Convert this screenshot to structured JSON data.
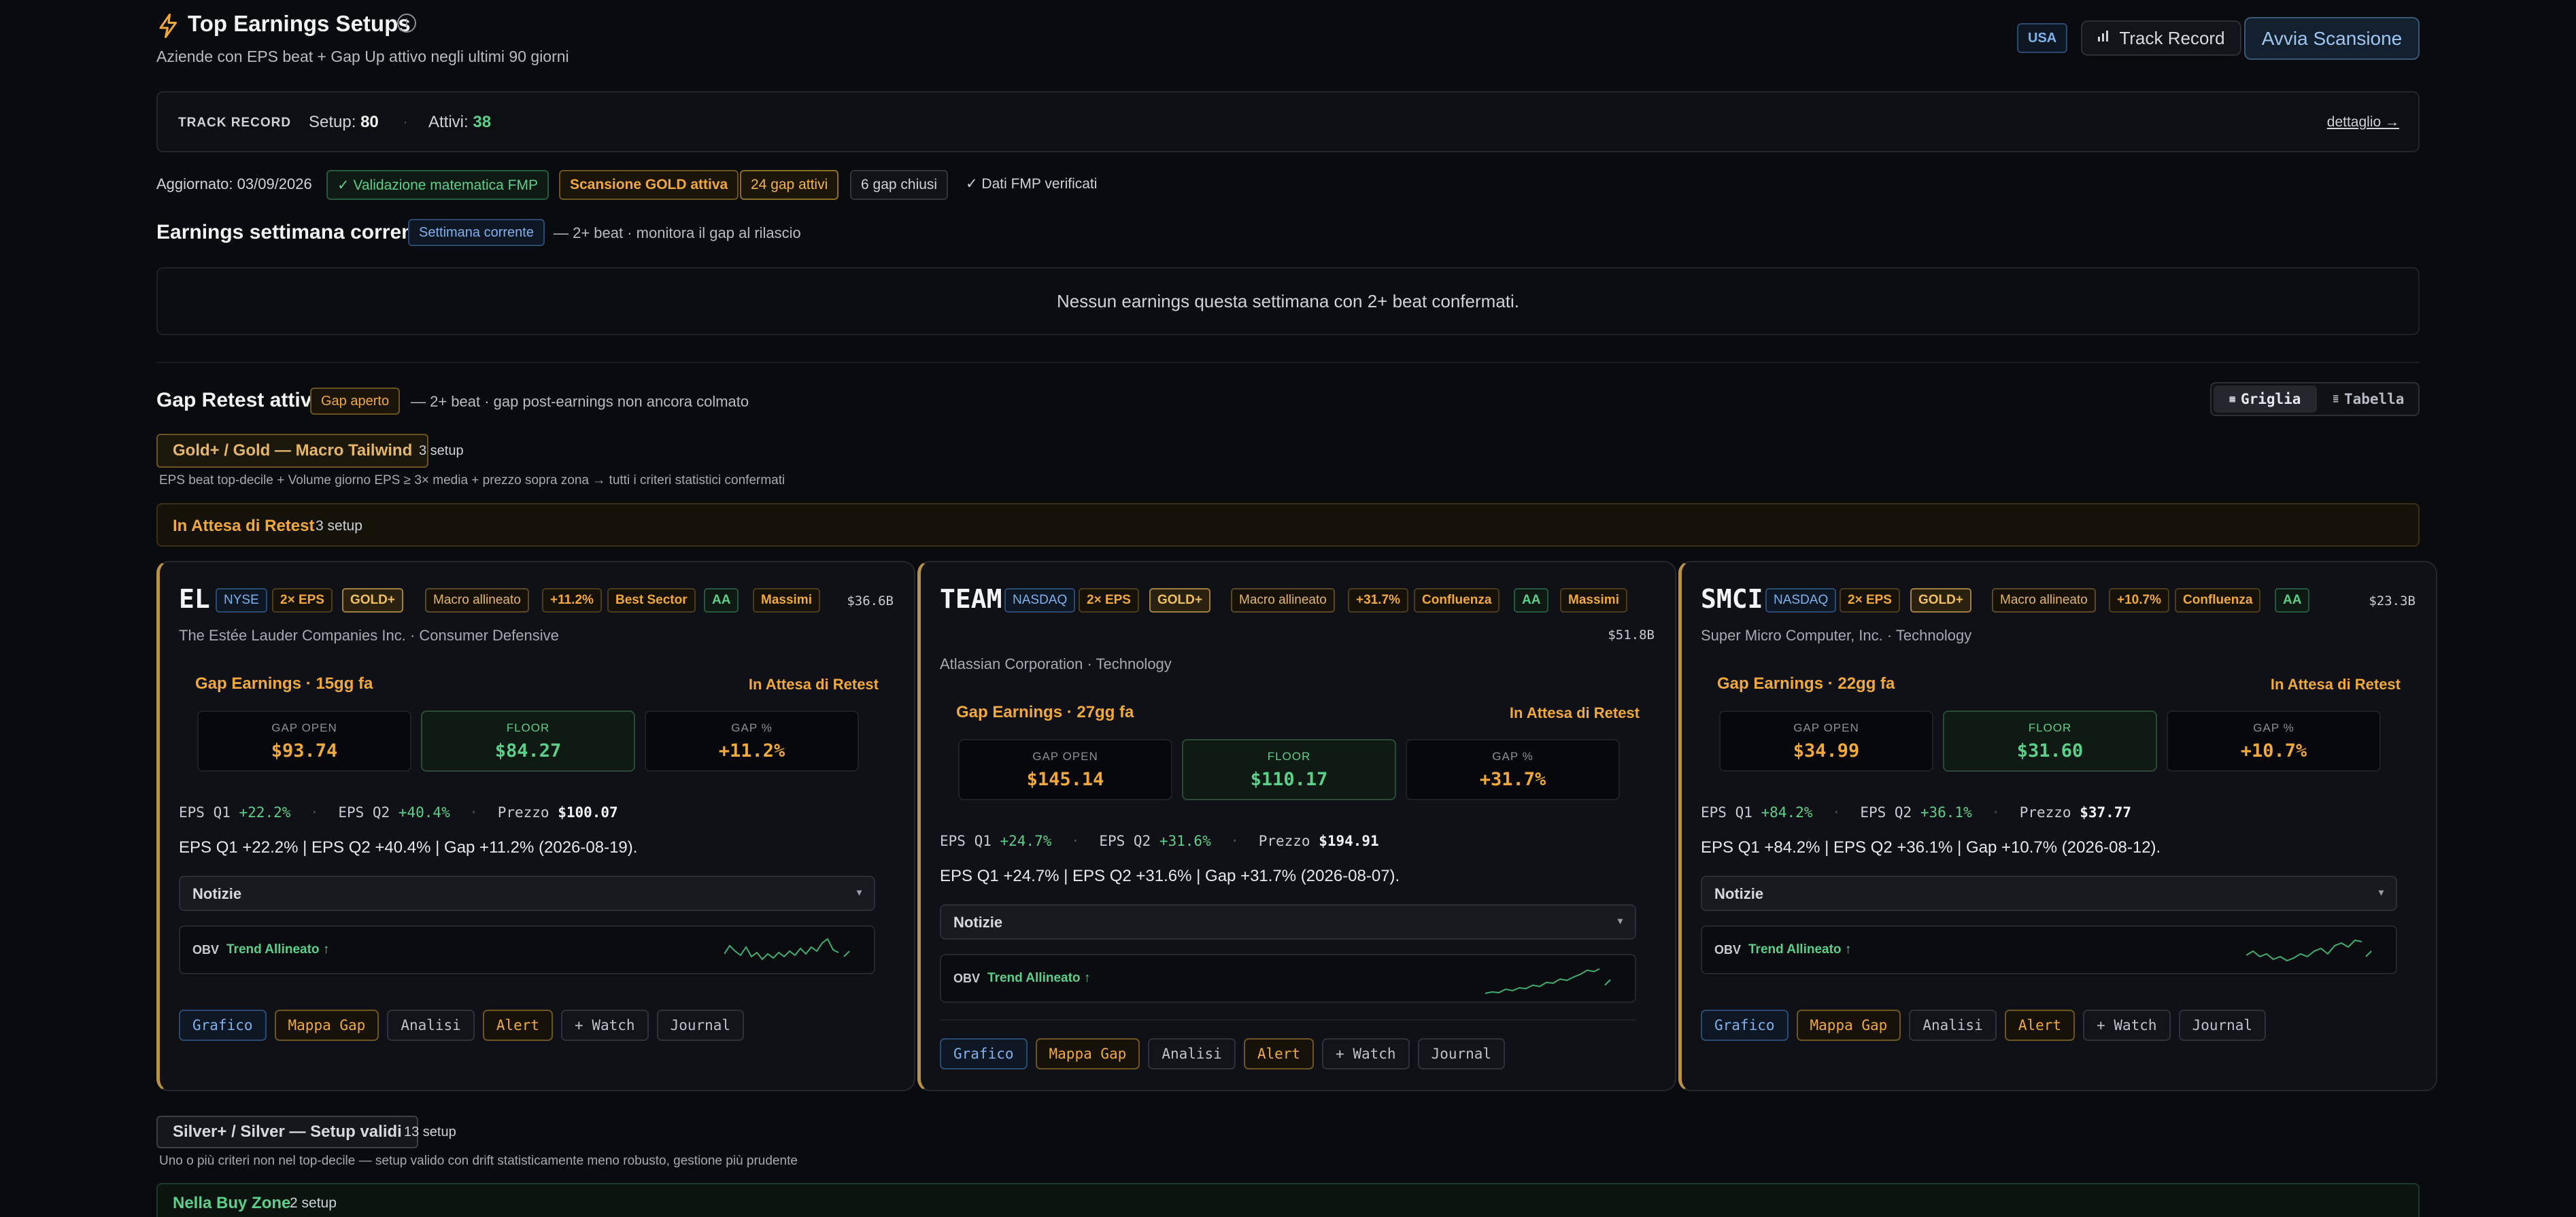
{
  "header": {
    "title": "Top Earnings Setups",
    "subtitle": "Aziende con EPS beat + Gap Up attivo negli ultimi 90 giorni",
    "market": "USA",
    "track_record_btn": "Track Record",
    "scan_btn": "Avvia Scansione"
  },
  "track": {
    "label": "TRACK RECORD",
    "setup_label": "Setup:",
    "setup_value": "80",
    "attivi_label": "Attivi:",
    "attivi_value": "38",
    "link": "dettaglio →"
  },
  "status": {
    "updated": "Aggiornato: 03/09/2026",
    "validation": "✓ Validazione matematica FMP",
    "scan": "Scansione GOLD attiva",
    "gaps_active": "24 gap attivi",
    "gaps_closed": "6 gap chiusi",
    "fmp": "✓ Dati FMP verificati"
  },
  "week": {
    "title": "Earnings settimana corrente",
    "badge": "Settimana corrente",
    "note": "— 2+ beat · monitora il gap al rilascio",
    "empty": "Nessun earnings questa settimana con 2+ beat confermati."
  },
  "retest": {
    "title": "Gap Retest attivi",
    "badge": "Gap aperto",
    "note": "— 2+ beat · gap post-earnings non ancora colmato",
    "view_grid": "Griglia",
    "view_table": "Tabella"
  },
  "gold": {
    "title": "Gold+ / Gold — Macro Tailwind",
    "count": "3 setup",
    "desc": "EPS beat top-decile + Volume giorno EPS ≥ 3× media + prezzo sopra zona → tutti i criteri statistici confermati",
    "waiting": "In Attesa di Retest",
    "waiting_count": "3 setup"
  },
  "cards": [
    {
      "ticker": "EL",
      "exchange": "NYSE",
      "eps": "2× EPS",
      "grade": "GOLD+",
      "macro": "Macro allineato",
      "pct": "+11.2%",
      "extra": "Best Sector",
      "rating": "AA",
      "massimi": "Massimi",
      "cap": "$36.6B",
      "company": "The Estée Lauder Companies Inc. · Consumer Defensive",
      "gap": "Gap Earnings · 15gg fa",
      "state": "In Attesa di Retest",
      "gap_open_lbl": "GAP OPEN",
      "gap_open": "$93.74",
      "floor_lbl": "FLOOR",
      "floor": "$84.27",
      "gap_pct_lbl": "GAP %",
      "gap_pct": "+11.2%",
      "q1_lbl": "EPS Q1",
      "q1": "+22.2%",
      "q2_lbl": "EPS Q2",
      "q2": "+40.4%",
      "price_lbl": "Prezzo",
      "price": "$100.07",
      "summary": "EPS Q1 +22.2% | EPS Q2 +40.4% | Gap +11.2% (2026-08-19).",
      "news": "Notizie",
      "obv": "OBV",
      "trend": "Trend Allineato ↑",
      "a1": "Grafico",
      "a2": "Mappa Gap",
      "a3": "Analisi",
      "a4": "Alert",
      "a5": "+ Watch",
      "a6": "Journal"
    },
    {
      "ticker": "TEAM",
      "exchange": "NASDAQ",
      "eps": "2× EPS",
      "grade": "GOLD+",
      "macro": "Macro allineato",
      "pct": "+31.7%",
      "extra": "Confluenza",
      "rating": "AA",
      "massimi": "Massimi",
      "cap": "$51.8B",
      "company": "Atlassian Corporation · Technology",
      "gap": "Gap Earnings · 27gg fa",
      "state": "In Attesa di Retest",
      "gap_open_lbl": "GAP OPEN",
      "gap_open": "$145.14",
      "floor_lbl": "FLOOR",
      "floor": "$110.17",
      "gap_pct_lbl": "GAP %",
      "gap_pct": "+31.7%",
      "q1_lbl": "EPS Q1",
      "q1": "+24.7%",
      "q2_lbl": "EPS Q2",
      "q2": "+31.6%",
      "price_lbl": "Prezzo",
      "price": "$194.91",
      "summary": "EPS Q1 +24.7% | EPS Q2 +31.6% | Gap +31.7% (2026-08-07).",
      "news": "Notizie",
      "obv": "OBV",
      "trend": "Trend Allineato ↑",
      "a1": "Grafico",
      "a2": "Mappa Gap",
      "a3": "Analisi",
      "a4": "Alert",
      "a5": "+ Watch",
      "a6": "Journal"
    },
    {
      "ticker": "SMCI",
      "exchange": "NASDAQ",
      "eps": "2× EPS",
      "grade": "GOLD+",
      "macro": "Macro allineato",
      "pct": "+10.7%",
      "extra": "Confluenza",
      "rating": "AA",
      "cap": "$23.3B",
      "company": "Super Micro Computer, Inc. · Technology",
      "gap": "Gap Earnings · 22gg fa",
      "state": "In Attesa di Retest",
      "gap_open_lbl": "GAP OPEN",
      "gap_open": "$34.99",
      "floor_lbl": "FLOOR",
      "floor": "$31.60",
      "gap_pct_lbl": "GAP %",
      "gap_pct": "+10.7%",
      "q1_lbl": "EPS Q1",
      "q1": "+84.2%",
      "q2_lbl": "EPS Q2",
      "q2": "+36.1%",
      "price_lbl": "Prezzo",
      "price": "$37.77",
      "summary": "EPS Q1 +84.2% | EPS Q2 +36.1% | Gap +10.7% (2026-08-12).",
      "news": "Notizie",
      "obv": "OBV",
      "trend": "Trend Allineato ↑",
      "a1": "Grafico",
      "a2": "Mappa Gap",
      "a3": "Analisi",
      "a4": "Alert",
      "a5": "+ Watch",
      "a6": "Journal"
    }
  ],
  "silver": {
    "title": "Silver+ / Silver — Setup validi",
    "count": "13 setup",
    "desc": "Uno o più criteri non nel top-decile — setup valido con drift statisticamente meno robusto, gestione più prudente",
    "buyzone": "Nella Buy Zone",
    "buyzone_count": "2 setup"
  },
  "colors": {
    "accent": "#f0a93a",
    "green": "#5ccf8b",
    "blue": "#7fb1ec",
    "bg": "#0a0b0e"
  }
}
